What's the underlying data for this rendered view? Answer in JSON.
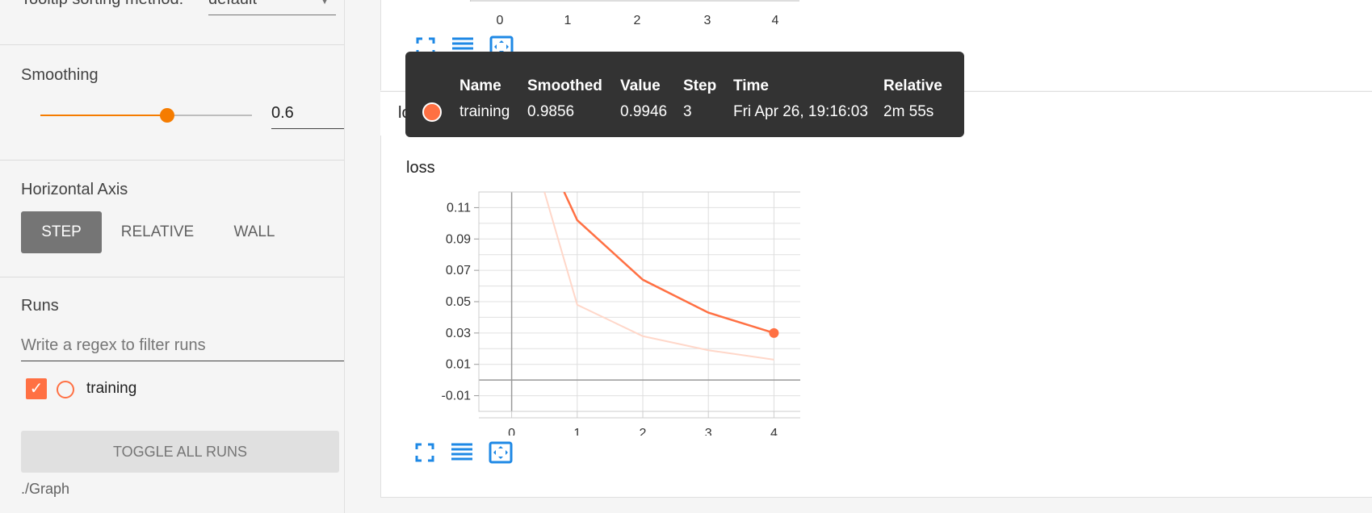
{
  "sidebar": {
    "tooltip_sorting_label": "Tooltip sorting method:",
    "tooltip_sorting_value": "default",
    "smoothing_label": "Smoothing",
    "smoothing_value": "0.6",
    "smoothing_fraction": 0.6,
    "horizontal_axis_label": "Horizontal Axis",
    "axis_options": [
      "STEP",
      "RELATIVE",
      "WALL"
    ],
    "axis_selected": "STEP",
    "runs_label": "Runs",
    "runs_filter_placeholder": "Write a regex to filter runs",
    "runs": [
      {
        "name": "training",
        "checked": true,
        "color": "#ff7043"
      }
    ],
    "toggle_all_label": "TOGGLE ALL RUNS",
    "log_dir": "./Graph"
  },
  "main": {
    "group_header": "loss",
    "chart_title": "loss",
    "top_chart_x_ticks": [
      "0",
      "1",
      "2",
      "3",
      "4"
    ]
  },
  "tooltip": {
    "headers": [
      "Name",
      "Smoothed",
      "Value",
      "Step",
      "Time",
      "Relative"
    ],
    "row": {
      "name": "training",
      "smoothed": "0.9856",
      "value": "0.9946",
      "step": "3",
      "time": "Fri Apr 26, 19:16:03",
      "relative": "2m 55s",
      "color": "#ff7043"
    }
  },
  "chart_data": {
    "type": "line",
    "title": "loss",
    "xlabel": "",
    "ylabel": "",
    "x_ticks": [
      "0",
      "1",
      "2",
      "3",
      "4"
    ],
    "y_ticks": [
      "0.11",
      "0.09",
      "0.07",
      "0.05",
      "0.03",
      "0.01",
      "-0.01"
    ],
    "xlim": [
      -0.5,
      4.5
    ],
    "ylim": [
      -0.02,
      0.12
    ],
    "grid": true,
    "series": [
      {
        "name": "training",
        "style": "smoothed",
        "color": "#ff7043",
        "x": [
          0.8,
          1,
          2,
          3,
          4
        ],
        "y": [
          0.12,
          0.102,
          0.064,
          0.043,
          0.03
        ]
      },
      {
        "name": "training",
        "style": "raw",
        "color": "#ffd7c9",
        "x": [
          0.5,
          1,
          2,
          3,
          4
        ],
        "y": [
          0.12,
          0.048,
          0.028,
          0.019,
          0.013
        ]
      }
    ],
    "highlight_point": {
      "x": 4,
      "y": 0.03
    }
  },
  "icons": {
    "fullscreen": "fullscreen-icon",
    "data_table": "data-table-icon",
    "fit_domain": "fit-domain-icon"
  }
}
